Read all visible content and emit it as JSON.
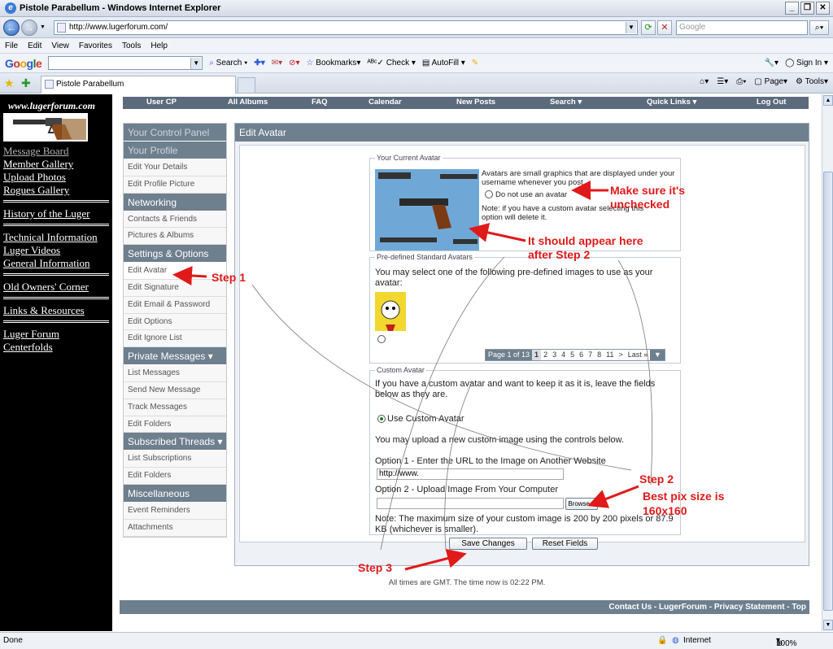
{
  "window": {
    "title": "Pistole Parabellum - Windows Internet Explorer"
  },
  "browser": {
    "url": "http://www.lugerforum.com/",
    "search_placeholder": "Google",
    "menu": [
      "File",
      "Edit",
      "View",
      "Favorites",
      "Tools",
      "Help"
    ],
    "google_toolbar": {
      "search": "Search",
      "bookmarks": "Bookmarks",
      "check": "Check",
      "autofill": "AutoFill",
      "signin": "Sign In"
    },
    "tab_title": "Pistole Parabellum",
    "right_tools": {
      "page": "Page",
      "tools": "Tools"
    },
    "status": {
      "left": "Done",
      "zone": "Internet",
      "zoom": "100%"
    }
  },
  "site_sidebar": {
    "url_text": "www.lugerforum.com",
    "links_group1": [
      "Message Board",
      "Member Gallery",
      "Upload Photos",
      "Rogues Gallery"
    ],
    "links_group2": [
      "History of the Luger"
    ],
    "links_group3": [
      "Technical Information",
      "Luger Videos",
      "General Information"
    ],
    "links_group4": [
      "Old Owners' Corner"
    ],
    "links_group5": [
      "Links & Resources"
    ],
    "links_group6": [
      "Luger Forum",
      "Centerfolds"
    ]
  },
  "navbar": [
    "User CP",
    "All Albums",
    "FAQ",
    "Calendar",
    "New Posts",
    "Search ▾",
    "Quick Links ▾",
    "Log Out"
  ],
  "cp_nav": {
    "your_control_panel": "Your Control Panel",
    "your_profile": "Your Profile",
    "profile_items": [
      "Edit Your Details",
      "Edit Profile Picture"
    ],
    "networking": "Networking",
    "networking_items": [
      "Contacts & Friends",
      "Pictures & Albums"
    ],
    "settings": "Settings & Options",
    "settings_items": [
      "Edit Avatar",
      "Edit Signature",
      "Edit Email & Password",
      "Edit Options",
      "Edit Ignore List"
    ],
    "private_messages": "Private Messages ▾",
    "pm_items": [
      "List Messages",
      "Send New Message",
      "Track Messages",
      "Edit Folders"
    ],
    "subscribed": "Subscribed Threads ▾",
    "subscribed_items": [
      "List Subscriptions",
      "Edit Folders"
    ],
    "misc": "Miscellaneous",
    "misc_items": [
      "Event Reminders",
      "Attachments"
    ]
  },
  "edit_avatar": {
    "title": "Edit Avatar",
    "current": {
      "legend": "Your Current Avatar",
      "desc": "Avatars are small graphics that are displayed under your username whenever you post.",
      "radio_label": "Do not use an avatar",
      "note": "Note: if you have a custom avatar selecting this option will delete it."
    },
    "predefined": {
      "legend": "Pre-defined Standard Avatars",
      "desc": "You may select one of the following pre-defined images to use as your avatar:",
      "pager": {
        "label": "Page 1 of 13",
        "pages": [
          "1",
          "2",
          "3",
          "4",
          "5",
          "6",
          "7",
          "8",
          "11",
          ">",
          "Last »"
        ]
      }
    },
    "custom": {
      "legend": "Custom Avatar",
      "desc": "If you have a custom avatar and want to keep it as it is, leave the fields below as they are.",
      "use_custom_label": "Use Custom Avatar",
      "upload_desc": "You may upload a new custom image using the controls below.",
      "option1": "Option 1 - Enter the URL to the Image on Another Website",
      "url_value": "http://www.",
      "option2": "Option 2 - Upload Image From Your Computer",
      "browse": "Browse...",
      "note": "Note: The maximum size of your custom image is 200 by 200 pixels or 87.9 KB (whichever is smaller)."
    },
    "save": "Save Changes",
    "reset": "Reset Fields"
  },
  "time_line": "All times are GMT. The time now is 02:22 PM.",
  "footer_links": "Contact Us - LugerForum - Privacy Statement - Top",
  "annotations": {
    "step1": "Step 1",
    "unchecked_1": "Make sure it's",
    "unchecked_2": "unchecked",
    "appear_1": "It should appear here",
    "appear_2": "after Step 2",
    "step2": "Step 2",
    "pix_1": "Best pix size is",
    "pix_2": "160x160",
    "step3": "Step 3"
  },
  "colors": {
    "annotation": "#e01a1a",
    "panel_header": "#6e7f8e",
    "navbar": "#5b6b7c"
  }
}
